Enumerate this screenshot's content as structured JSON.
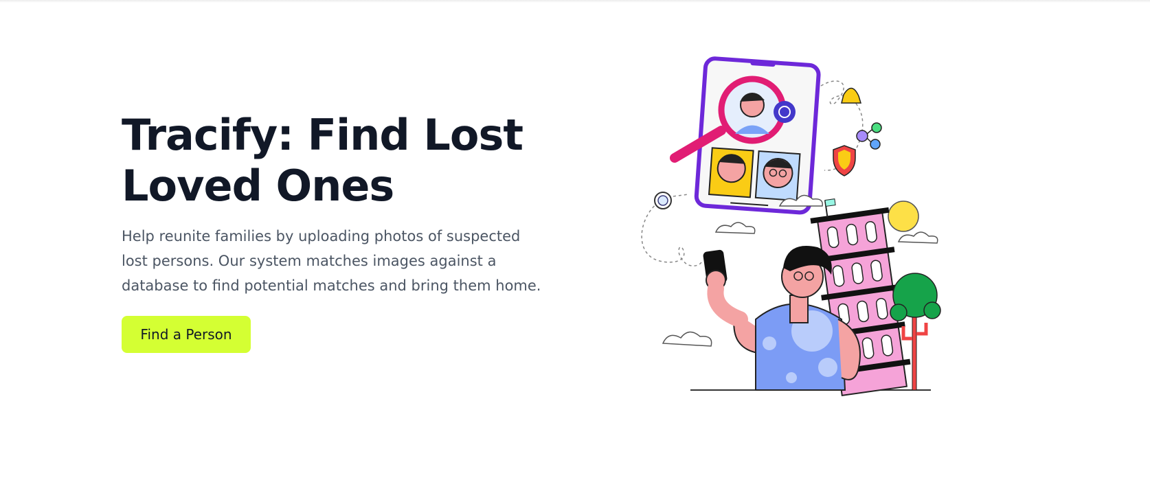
{
  "hero": {
    "title": "Tracify: Find Lost Loved Ones",
    "description": "Help reunite families by uploading photos of suspected lost persons. Our system matches images against a database to find potential matches and bring them home.",
    "cta_label": "Find a Person"
  },
  "colors": {
    "accent": "#d4ff33",
    "heading": "#111827",
    "body_text": "#4b5563"
  },
  "illustration": {
    "icon": "person-taking-selfie-illustration"
  }
}
